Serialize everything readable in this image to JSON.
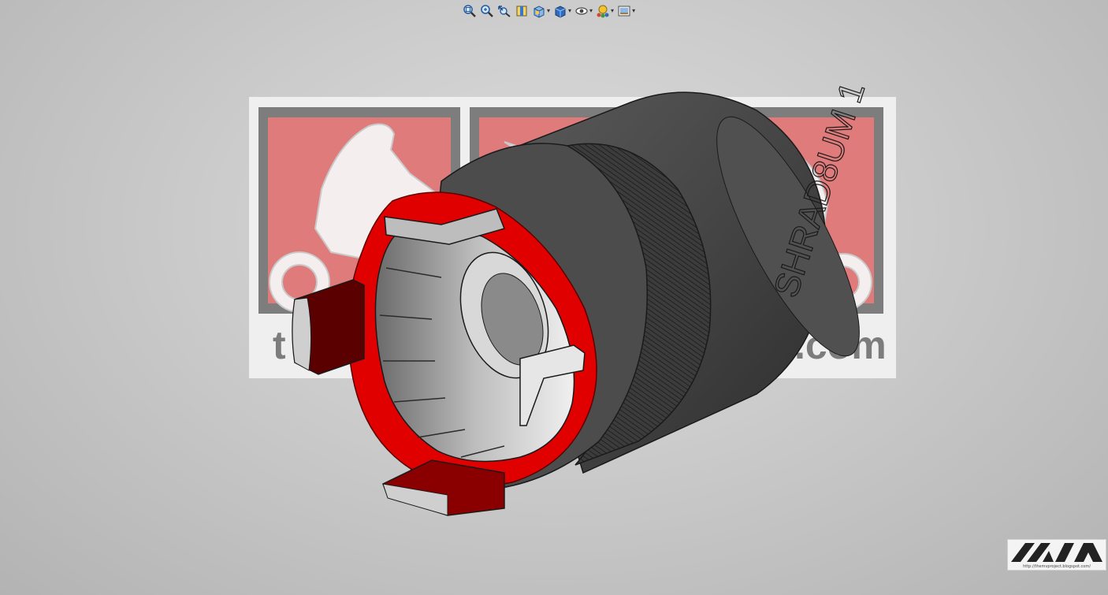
{
  "toolbar": {
    "buttons": [
      {
        "name": "zoom-to-fit-button",
        "icon": "zoom-fit-icon",
        "dropdown": false
      },
      {
        "name": "zoom-to-area-button",
        "icon": "zoom-area-icon",
        "dropdown": false
      },
      {
        "name": "previous-view-button",
        "icon": "previous-view-icon",
        "dropdown": false
      },
      {
        "name": "section-view-button",
        "icon": "section-view-icon",
        "dropdown": false
      },
      {
        "name": "view-orientation-button",
        "icon": "view-orientation-icon",
        "dropdown": true
      },
      {
        "name": "display-style-button",
        "icon": "display-style-icon",
        "dropdown": true
      },
      {
        "name": "hide-show-items-button",
        "icon": "hide-show-icon",
        "dropdown": true
      },
      {
        "name": "edit-appearance-button",
        "icon": "appearance-icon",
        "dropdown": true
      },
      {
        "name": "apply-scene-button",
        "icon": "scene-icon",
        "dropdown": true
      }
    ],
    "caret": "▾"
  },
  "background_decal": {
    "text_left": "t",
    "text_right": ".com",
    "frame_color": "#f2f2f2",
    "panel_color": "#e07b7b",
    "border_color": "#7d7d7d"
  },
  "model": {
    "engraved_text": "SHRAD8UM 1",
    "body_color": "#4a4a4a",
    "section_color": "#e00000"
  },
  "watermark": {
    "logo": "mva-logo",
    "url": "http://themvproject.blogspot.com/"
  }
}
